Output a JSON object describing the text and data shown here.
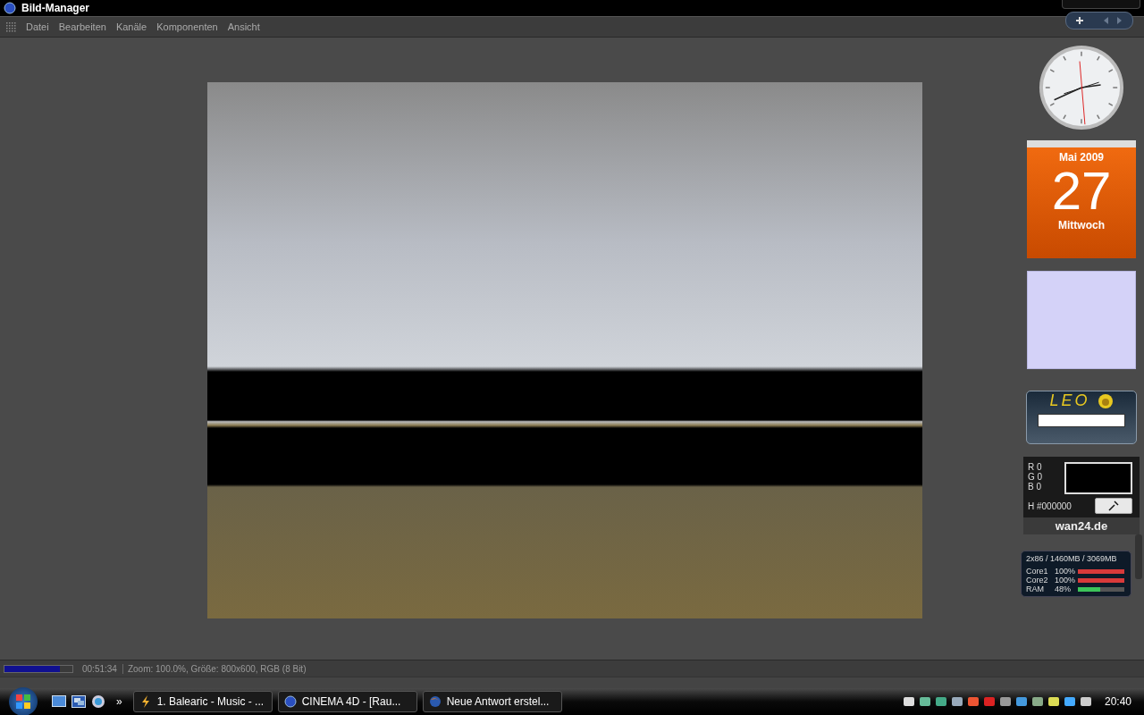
{
  "window": {
    "title": "Bild-Manager"
  },
  "menu": [
    {
      "label": "Datei"
    },
    {
      "label": "Bearbeiten"
    },
    {
      "label": "Kanäle"
    },
    {
      "label": "Komponenten"
    },
    {
      "label": "Ansicht"
    }
  ],
  "status_bar": {
    "progress": {
      "level": 0.82
    },
    "time": "00:51:34",
    "info": "Zoom: 100.0%, Größe: 800x600, RGB (8 Bit)"
  },
  "gadgets": {
    "calendar": {
      "month": "Mai 2009",
      "day": "27",
      "weekday": "Mittwoch"
    },
    "leo": {
      "logo": "LEO"
    },
    "color_picker": {
      "channels": [
        "R 0",
        "G 0",
        "B 0"
      ],
      "hex": "H #000000",
      "brand": "wan24.de"
    },
    "system_meter": {
      "summary": "2x86 / 1460MB / 3069MB",
      "rows": [
        {
          "label": "Core1",
          "reading": "100%",
          "level": 1,
          "color": "#d83a3a"
        },
        {
          "label": "Core2",
          "reading": "100%",
          "level": 1,
          "color": "#d83a3a"
        },
        {
          "label": "RAM",
          "reading": "48%",
          "level": 0.48,
          "color": "#3cc45a"
        }
      ]
    }
  },
  "taskbar": {
    "overflow": "»",
    "tasks": [
      {
        "label": "1. Balearic - Music - ...",
        "kind": "player",
        "selected": false
      },
      {
        "label": "CINEMA 4D - [Rau...",
        "kind": "cinema",
        "selected": false
      },
      {
        "label": "Neue Antwort erstel...",
        "kind": "browser",
        "selected": false
      }
    ],
    "clock": "20:40"
  }
}
